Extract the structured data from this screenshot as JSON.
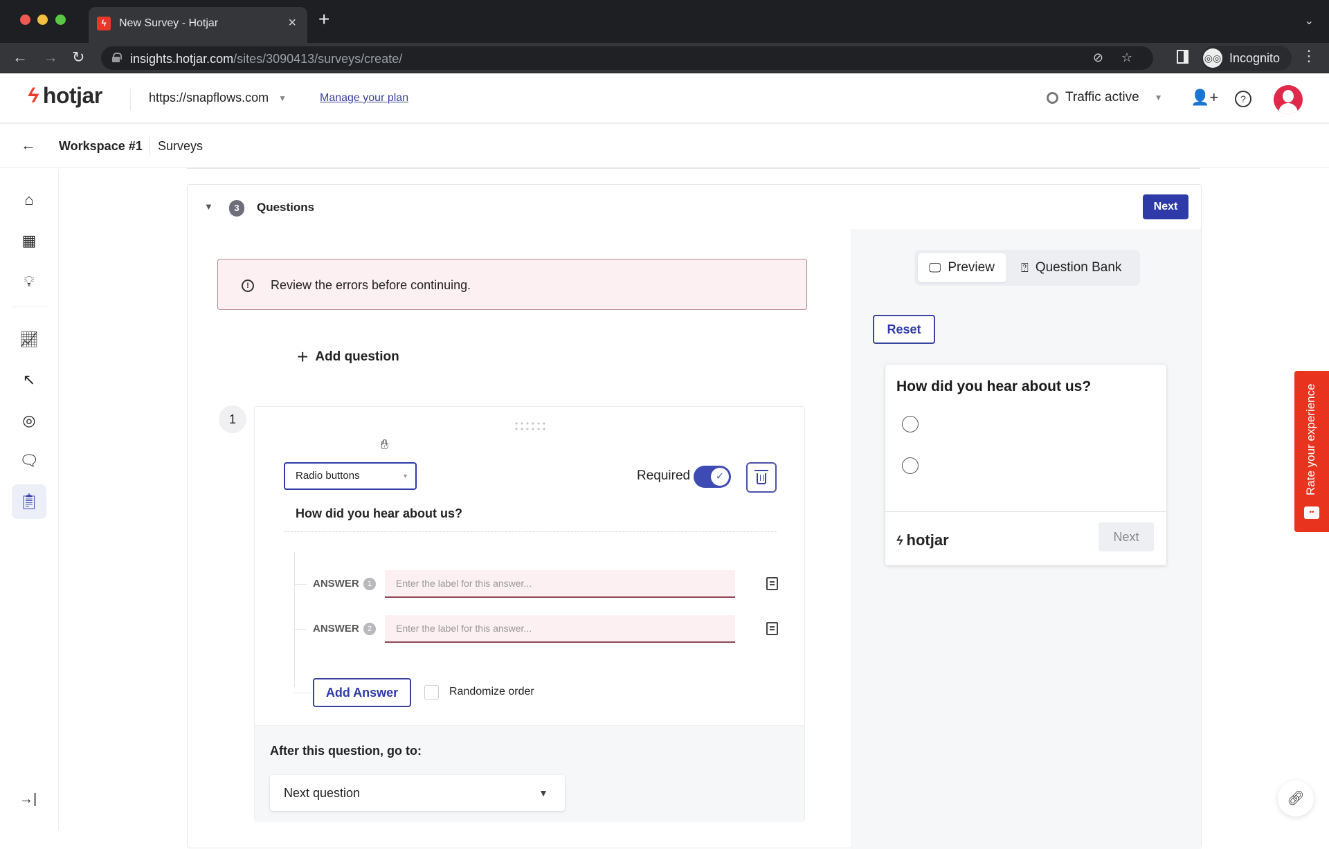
{
  "browser": {
    "tab_title": "New Survey - Hotjar",
    "url_host": "insights.hotjar.com",
    "url_path": "/sites/3090413/surveys/create/",
    "profile_label": "Incognito"
  },
  "header": {
    "logo_text": "hotjar",
    "site": "https://snapflows.com",
    "manage_plan": "Manage your plan",
    "traffic_status": "Traffic active"
  },
  "breadcrumb": {
    "workspace": "Workspace #1",
    "section": "Surveys"
  },
  "sidebar": {
    "items": [
      {
        "icon": "home-icon",
        "active": false
      },
      {
        "icon": "dashboard-icon",
        "active": false
      },
      {
        "icon": "lightbulb-icon",
        "active": false
      },
      {
        "icon": "trends-icon",
        "active": false
      },
      {
        "icon": "recordings-icon",
        "active": false
      },
      {
        "icon": "feedback-icon",
        "active": false
      },
      {
        "icon": "interviews-icon",
        "active": false
      },
      {
        "icon": "surveys-icon",
        "active": true
      }
    ]
  },
  "questions_step": {
    "step_number": "3",
    "title": "Questions",
    "next_label": "Next",
    "error_message": "Review the errors before continuing.",
    "add_question_label": "Add question"
  },
  "question": {
    "number": "1",
    "type": "Radio buttons",
    "required_label": "Required",
    "required": true,
    "text": "How did you hear about us?",
    "answers": [
      {
        "label": "ANSWER",
        "index": "1",
        "value": "",
        "placeholder": "Enter the label for this answer..."
      },
      {
        "label": "ANSWER",
        "index": "2",
        "value": "",
        "placeholder": "Enter the label for this answer..."
      }
    ],
    "add_answer_label": "Add Answer",
    "randomize_label": "Randomize order",
    "randomize": false,
    "after_label": "After this question, go to:",
    "after_value": "Next question"
  },
  "preview": {
    "tab_preview": "Preview",
    "tab_bank": "Question Bank",
    "reset_label": "Reset",
    "widget_question": "How did you hear about us?",
    "widget_logo": "hotjar",
    "widget_next": "Next"
  },
  "feedback_tab": {
    "label": "Rate your experience"
  },
  "colors": {
    "brand_red": "#ec3a2a",
    "primary_blue": "#2e3aa8",
    "error_bg": "#fdf0f2",
    "avatar_red": "#e0284a"
  }
}
